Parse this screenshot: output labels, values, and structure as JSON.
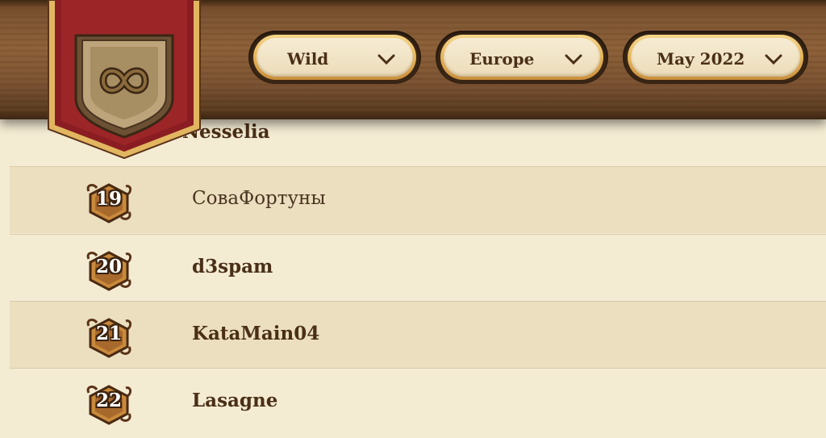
{
  "filters": {
    "mode": "Wild",
    "region": "Europe",
    "season": "May 2022"
  },
  "partial_row_name": "Nesselia",
  "rows": [
    {
      "rank": "19",
      "name": "СоваФортуны"
    },
    {
      "rank": "20",
      "name": "d3spam"
    },
    {
      "rank": "21",
      "name": "KataMain04"
    },
    {
      "rank": "22",
      "name": "Lasagne"
    }
  ],
  "icons": {
    "logo": "hearthstone-infinity-shield-icon",
    "dropdown": "chevron-down-icon",
    "rank_badge": "rank-gem-icon"
  },
  "colors": {
    "wood": "#7b5230",
    "parchment": "#f4ebd3",
    "alt_row": "#ebdfbf",
    "gold": "#e6b55a",
    "crimson": "#8a1d22",
    "text": "#4a2f17"
  }
}
